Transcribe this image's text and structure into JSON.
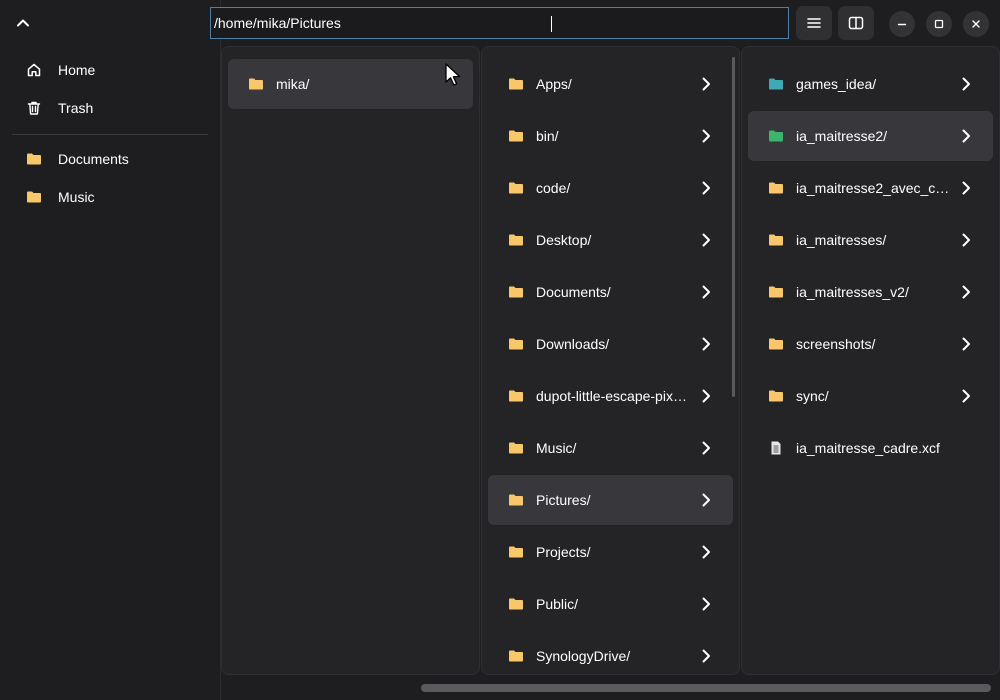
{
  "path": {
    "value": "/home/mika/Pictures"
  },
  "header": {
    "menu_icon": "hamburger-menu-icon",
    "view_icon": "split-view-icon"
  },
  "window_controls": [
    "minimize-icon",
    "maximize-icon",
    "close-icon"
  ],
  "sidebar": {
    "places": [
      {
        "label": "Home",
        "icon": "home-icon"
      },
      {
        "label": "Trash",
        "icon": "trash-icon"
      }
    ],
    "bookmarks": [
      {
        "label": "Documents",
        "icon": "folder-icon"
      },
      {
        "label": "Music",
        "icon": "folder-icon"
      }
    ]
  },
  "columns": [
    {
      "items": [
        {
          "name": "mika/",
          "type": "folder",
          "selected": true
        }
      ]
    },
    {
      "items": [
        {
          "name": "Apps/",
          "type": "folder"
        },
        {
          "name": "bin/",
          "type": "folder"
        },
        {
          "name": "code/",
          "type": "folder"
        },
        {
          "name": "Desktop/",
          "type": "folder"
        },
        {
          "name": "Documents/",
          "type": "folder"
        },
        {
          "name": "Downloads/",
          "type": "folder"
        },
        {
          "name": "dupot-little-escape-pix…",
          "type": "folder"
        },
        {
          "name": "Music/",
          "type": "folder"
        },
        {
          "name": "Pictures/",
          "type": "folder",
          "selected": true
        },
        {
          "name": "Projects/",
          "type": "folder"
        },
        {
          "name": "Public/",
          "type": "folder"
        },
        {
          "name": "SynologyDrive/",
          "type": "folder"
        }
      ]
    },
    {
      "items": [
        {
          "name": "games_idea/",
          "type": "folder",
          "color": "#3fa9b5"
        },
        {
          "name": "ia_maitresse2/",
          "type": "folder",
          "color": "#3cb46e",
          "selected": true
        },
        {
          "name": "ia_maitresse2_avec_ca…",
          "type": "folder"
        },
        {
          "name": "ia_maitresses/",
          "type": "folder"
        },
        {
          "name": "ia_maitresses_v2/",
          "type": "folder"
        },
        {
          "name": "screenshots/",
          "type": "folder"
        },
        {
          "name": "sync/",
          "type": "folder"
        },
        {
          "name": "ia_maitresse_cadre.xcf",
          "type": "file"
        }
      ]
    }
  ],
  "colors": {
    "folder": "#f8c76b",
    "selection": "#38383c",
    "accent_border": "#4f7fa6"
  }
}
